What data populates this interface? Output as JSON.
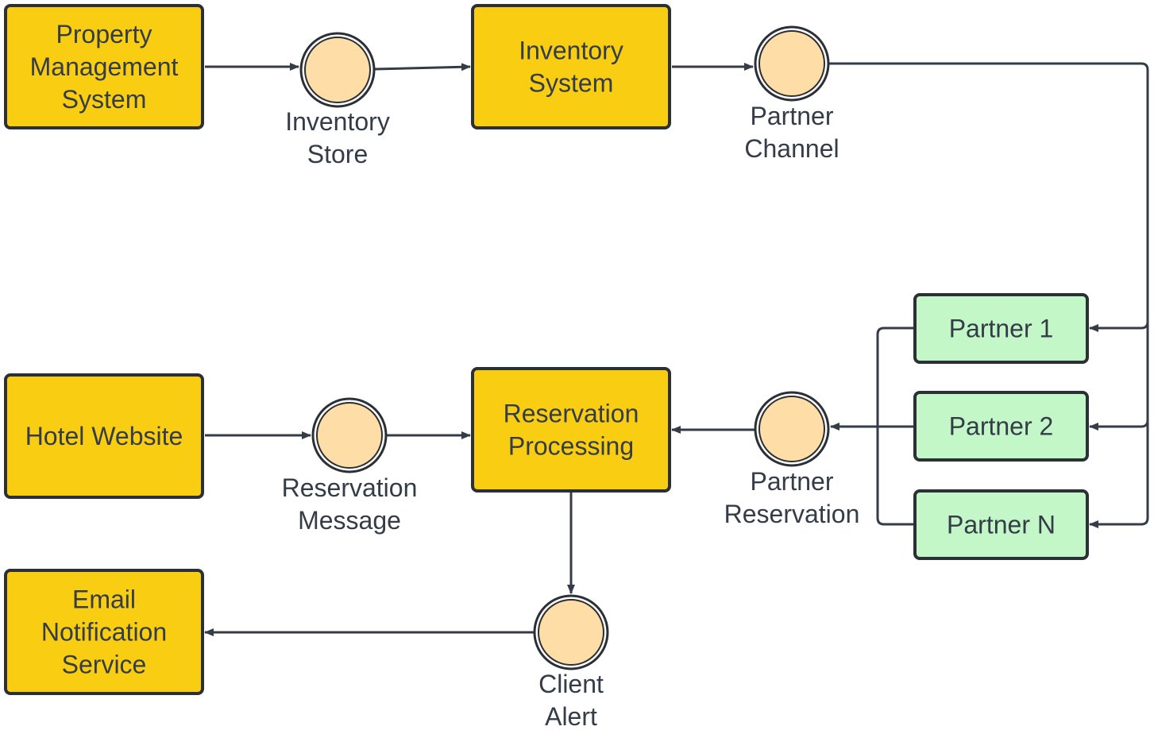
{
  "colors": {
    "system": "#f9cd12",
    "event": "#fedda6",
    "partner": "#c3f7c8",
    "stroke": "#2b2f36",
    "text": "#343c48"
  },
  "nodes": {
    "pms": {
      "lines": [
        "Property",
        "Management",
        "System"
      ]
    },
    "inventory_system": {
      "lines": [
        "Inventory",
        "System"
      ]
    },
    "hotel_website": {
      "lines": [
        "Hotel Website"
      ]
    },
    "reservation_processing": {
      "lines": [
        "Reservation",
        "Processing"
      ]
    },
    "email_service": {
      "lines": [
        "Email",
        "Notification",
        "Service"
      ]
    },
    "partner1": {
      "lines": [
        "Partner 1"
      ]
    },
    "partner2": {
      "lines": [
        "Partner 2"
      ]
    },
    "partnerN": {
      "lines": [
        "Partner N"
      ]
    }
  },
  "events": {
    "inventory_store": {
      "lines": [
        "Inventory",
        "Store"
      ]
    },
    "partner_channel": {
      "lines": [
        "Partner",
        "Channel"
      ]
    },
    "reservation_message": {
      "lines": [
        "Reservation",
        "Message"
      ]
    },
    "partner_reservation": {
      "lines": [
        "Partner",
        "Reservation"
      ]
    },
    "client_alert": {
      "lines": [
        "Client",
        "Alert"
      ]
    }
  }
}
